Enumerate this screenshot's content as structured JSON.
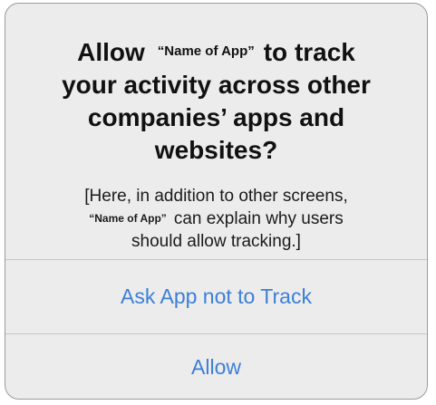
{
  "alert": {
    "title": {
      "line1_prefix": "Allow",
      "app_name": "“Name of App”",
      "line1_suffix": "to track",
      "line2": "your activity across other",
      "line3": "companies’ apps and",
      "line4": "websites?"
    },
    "body": {
      "line1": "[Here, in addition to other screens,",
      "app_name": "“Name of App”",
      "line2_suffix": "can explain why users",
      "line3": "should allow tracking.]"
    },
    "buttons": {
      "ask_not_to_track": "Ask App not to Track",
      "allow": "Allow"
    },
    "colors": {
      "background": "#ececec",
      "title_text": "#111111",
      "button_text": "#3d7fd6",
      "divider": "#c7c7cc"
    }
  }
}
